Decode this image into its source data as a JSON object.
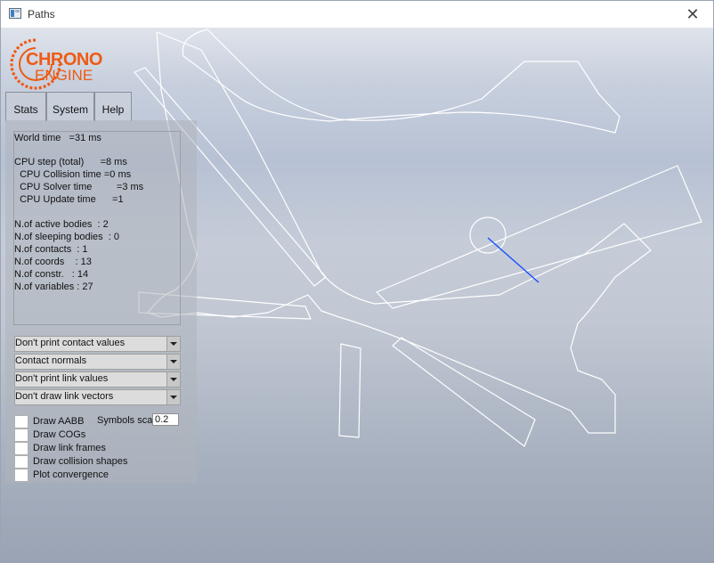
{
  "window": {
    "title": "Paths",
    "close_glyph": "✕"
  },
  "logo": {
    "line1": "CHRONO",
    "line2": "ENGINE",
    "accent": "#ee5a14"
  },
  "tabs": [
    {
      "label": "Stats",
      "active": true
    },
    {
      "label": "System",
      "active": false
    },
    {
      "label": "Help",
      "active": false
    }
  ],
  "stats": [
    "World time   =31 ms",
    "",
    "CPU step (total)      =8 ms",
    "  CPU Collision time =0 ms",
    "  CPU Solver time         =3 ms",
    "  CPU Update time      =1",
    "",
    "N.of active bodies  : 2",
    "N.of sleeping bodies  : 0",
    "N.of contacts  : 1",
    "N.of coords    : 13",
    "N.of constr.   : 14",
    "N.of variables : 27"
  ],
  "dropdowns": [
    {
      "value": "Don't print contact values"
    },
    {
      "value": "Contact normals"
    },
    {
      "value": "Don't print link values"
    },
    {
      "value": "Don't draw link vectors"
    }
  ],
  "checkboxes": [
    {
      "label": "Draw AABB",
      "checked": false
    },
    {
      "label": "Draw COGs",
      "checked": false
    },
    {
      "label": "Draw link frames",
      "checked": false
    },
    {
      "label": "Draw collision shapes",
      "checked": false
    },
    {
      "label": "Plot convergence",
      "checked": false
    }
  ],
  "symbols_scale": {
    "label": "Symbols scale",
    "value": "0.2"
  },
  "colors": {
    "wireframe": "#ffffff",
    "contact_vector": "#1a4cff"
  }
}
